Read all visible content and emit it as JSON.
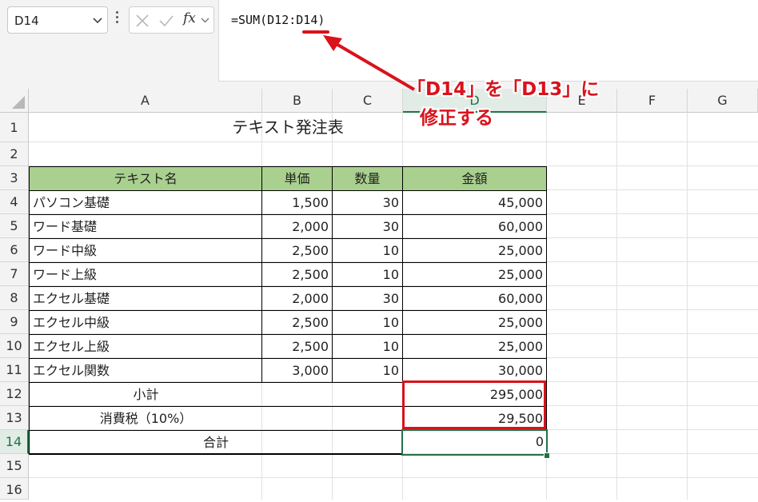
{
  "toolbar": {
    "namebox_value": "D14",
    "fx_label": "fx",
    "formula": "=SUM(D12:D14)"
  },
  "columns": [
    "A",
    "B",
    "C",
    "D",
    "E",
    "F",
    "G"
  ],
  "rows": [
    "1",
    "2",
    "3",
    "4",
    "5",
    "6",
    "7",
    "8",
    "9",
    "10",
    "11",
    "12",
    "13",
    "14",
    "15",
    "16"
  ],
  "sheet": {
    "title": "テキスト発注表",
    "headers": [
      "テキスト名",
      "単価",
      "数量",
      "金額"
    ],
    "items": [
      {
        "name": "パソコン基礎",
        "price": "1,500",
        "qty": "30",
        "amount": "45,000"
      },
      {
        "name": "ワード基礎",
        "price": "2,000",
        "qty": "30",
        "amount": "60,000"
      },
      {
        "name": "ワード中級",
        "price": "2,500",
        "qty": "10",
        "amount": "25,000"
      },
      {
        "name": "ワード上級",
        "price": "2,500",
        "qty": "10",
        "amount": "25,000"
      },
      {
        "name": "エクセル基礎",
        "price": "2,000",
        "qty": "30",
        "amount": "60,000"
      },
      {
        "name": "エクセル中級",
        "price": "2,500",
        "qty": "10",
        "amount": "25,000"
      },
      {
        "name": "エクセル上級",
        "price": "2,500",
        "qty": "10",
        "amount": "25,000"
      },
      {
        "name": "エクセル関数",
        "price": "3,000",
        "qty": "10",
        "amount": "30,000"
      }
    ],
    "subtotal_label": "小計",
    "subtotal_value": "295,000",
    "tax_label": "消費税（10%）",
    "tax_value": "29,500",
    "total_label": "合計",
    "total_value": "0"
  },
  "annotation": {
    "line1": "「D14」を「D13」に",
    "line2": "修正する"
  },
  "colors": {
    "header_fill": "#a9d08e",
    "selection": "#217346",
    "highlight": "#d9121c"
  }
}
